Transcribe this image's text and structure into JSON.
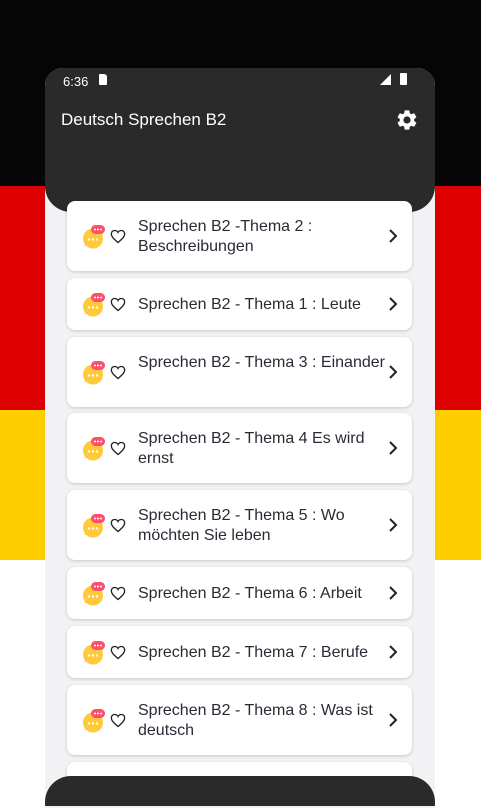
{
  "status_bar": {
    "time": "6:36"
  },
  "app_bar": {
    "title": "Deutsch Sprechen B2",
    "settings_icon": "gear-icon"
  },
  "colors": {
    "flag_black": "#050505",
    "flag_red": "#dd0000",
    "flag_gold": "#ffce00",
    "app_bar": "#2a2a2a",
    "chat_icon": "#ffc93a",
    "chat_bubble": "#ff4d6d"
  },
  "topics": [
    {
      "label": "Sprechen B2 -Thema 2 : Beschreibungen",
      "icon": "chat-icon",
      "favorite_icon": "heart-outline-icon"
    },
    {
      "label": "Sprechen B2 - Thema 1 : Leute",
      "icon": "chat-icon",
      "favorite_icon": "heart-outline-icon"
    },
    {
      "label": "Sprechen B2 - Thema 3 : Einander",
      "icon": "chat-icon",
      "favorite_icon": "heart-outline-icon"
    },
    {
      "label": "Sprechen B2 - Thema 4 Es wird ernst",
      "icon": "chat-icon",
      "favorite_icon": "heart-outline-icon"
    },
    {
      "label": "Sprechen B2 - Thema 5 : Wo möchten Sie leben",
      "icon": "chat-icon",
      "favorite_icon": "heart-outline-icon"
    },
    {
      "label": "Sprechen B2 - Thema 6 : Arbeit",
      "icon": "chat-icon",
      "favorite_icon": "heart-outline-icon"
    },
    {
      "label": "Sprechen B2 - Thema 7 : Berufe",
      "icon": "chat-icon",
      "favorite_icon": "heart-outline-icon"
    },
    {
      "label": "Sprechen B2 - Thema 8 : Was ist deutsch",
      "icon": "chat-icon",
      "favorite_icon": "heart-outline-icon"
    }
  ]
}
